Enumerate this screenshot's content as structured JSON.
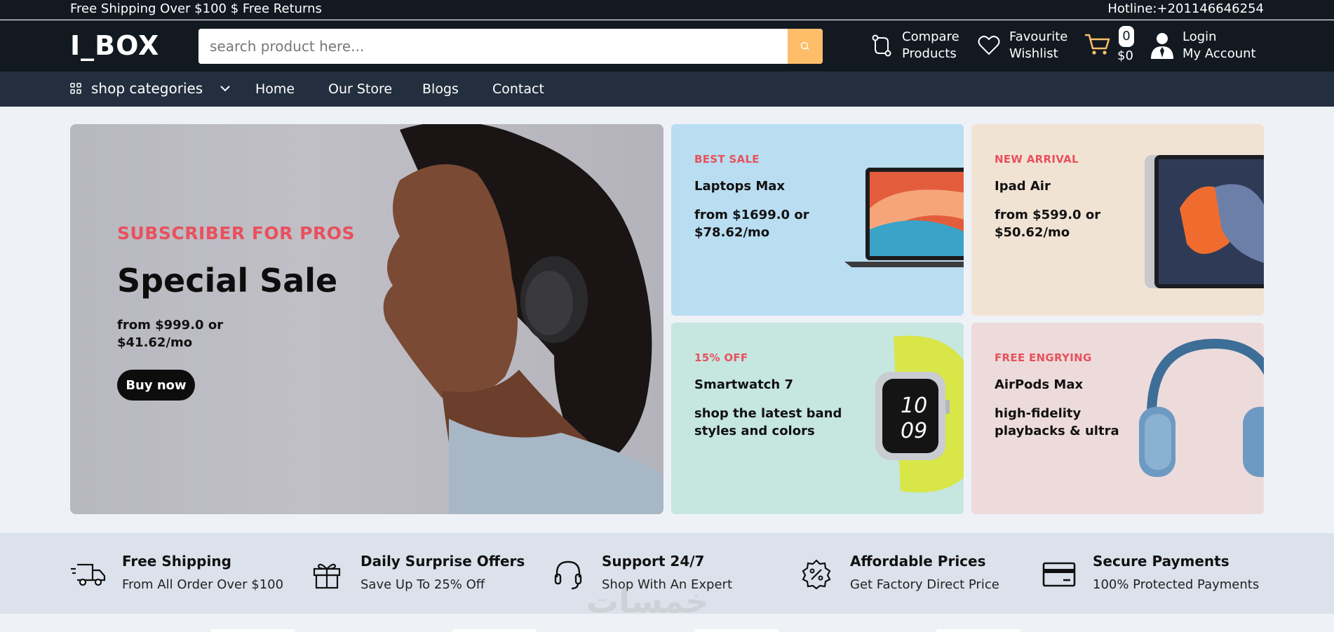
{
  "topbar": {
    "promo": "Free Shipping Over $100 $ Free Returns",
    "hotline": "Hotline:+201146646254"
  },
  "header": {
    "logo": "I_BOX",
    "search_placeholder": "search product here...",
    "compare": {
      "line1": "Compare",
      "line2": "Products",
      "icon": "compare-icon"
    },
    "wishlist": {
      "line1": "Favourite",
      "line2": "Wishlist",
      "icon": "heart-icon"
    },
    "cart": {
      "count": "0",
      "total": "$0",
      "icon": "cart-icon"
    },
    "account": {
      "line1": "Login",
      "line2": "My Account",
      "icon": "user-icon"
    }
  },
  "nav": {
    "categories_label": "shop categories",
    "items": [
      "Home",
      "Our Store",
      "Blogs",
      "Contact"
    ]
  },
  "hero": {
    "eyebrow": "SUBSCRIBER FOR PROS",
    "title": "Special Sale",
    "price": "from $999.0 or $41.62/mo",
    "button": "Buy now"
  },
  "tiles": [
    {
      "eyebrow": "BEST SALE",
      "name": "Laptops Max",
      "desc": "from $1699.0 or $78.62/mo",
      "bg": "#b9ddf1",
      "image": "laptop"
    },
    {
      "eyebrow": "NEW ARRIVAL",
      "name": "Ipad Air",
      "desc": "from $599.0 or $50.62/mo",
      "bg": "#f1e3d4",
      "image": "tablet"
    },
    {
      "eyebrow": "15% OFF",
      "name": "Smartwatch 7",
      "desc": "shop the latest band styles and colors",
      "bg": "#c6e6e0",
      "image": "smartwatch"
    },
    {
      "eyebrow": "FREE ENGRYING",
      "name": "AirPods Max",
      "desc": "high-fidelity playbacks & ultra",
      "bg": "#eddbdb",
      "image": "headphones"
    }
  ],
  "services": [
    {
      "title": "Free Shipping",
      "sub": "From All Order Over $100",
      "icon": "truck-icon"
    },
    {
      "title": "Daily Surprise Offers",
      "sub": "Save Up To 25% Off",
      "icon": "gift-icon"
    },
    {
      "title": "Support 24/7",
      "sub": "Shop With An Expert",
      "icon": "headset-icon"
    },
    {
      "title": "Affordable Prices",
      "sub": "Get Factory Direct Price",
      "icon": "discount-icon"
    },
    {
      "title": "Secure Payments",
      "sub": "100% Protected Payments",
      "icon": "card-icon"
    }
  ],
  "watermark": "خمسات",
  "colors": {
    "dark": "#131921",
    "nav": "#232f3e",
    "accent": "#febd69",
    "sale": "#e8515d"
  }
}
